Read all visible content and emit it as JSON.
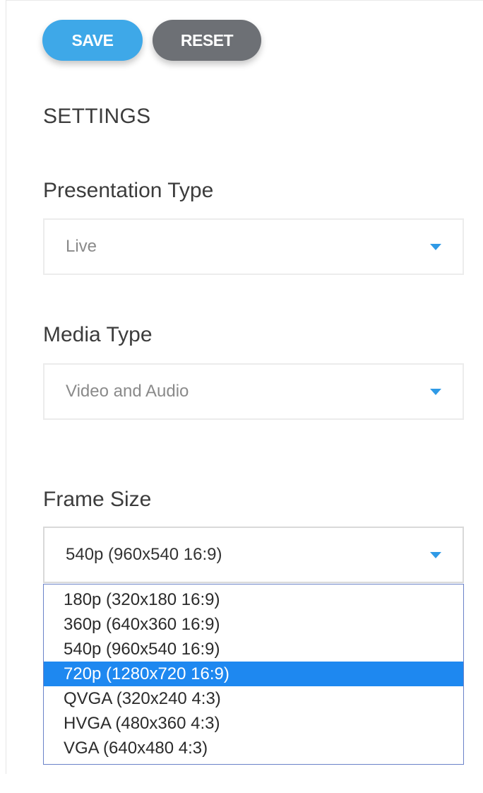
{
  "toolbar": {
    "save_label": "SAVE",
    "reset_label": "RESET"
  },
  "settings": {
    "title": "SETTINGS",
    "presentation_type": {
      "label": "Presentation Type",
      "value": "Live"
    },
    "media_type": {
      "label": "Media Type",
      "value": "Video and Audio"
    },
    "frame_size": {
      "label": "Frame Size",
      "value": "540p (960x540 16:9)",
      "options": [
        "180p (320x180 16:9)",
        "360p (640x360 16:9)",
        "540p (960x540 16:9)",
        "720p (1280x720 16:9)",
        "QVGA (320x240 4:3)",
        "HVGA (480x360 4:3)",
        "VGA (640x480 4:3)"
      ],
      "highlighted_option": "720p (1280x720 16:9)"
    }
  },
  "colors": {
    "save_button": "#3ea8e8",
    "reset_button": "#6d7075",
    "caret": "#2f9ae6",
    "highlight": "#1e88f0"
  },
  "icons": {
    "dropdown_caret": "caret-down-icon"
  }
}
